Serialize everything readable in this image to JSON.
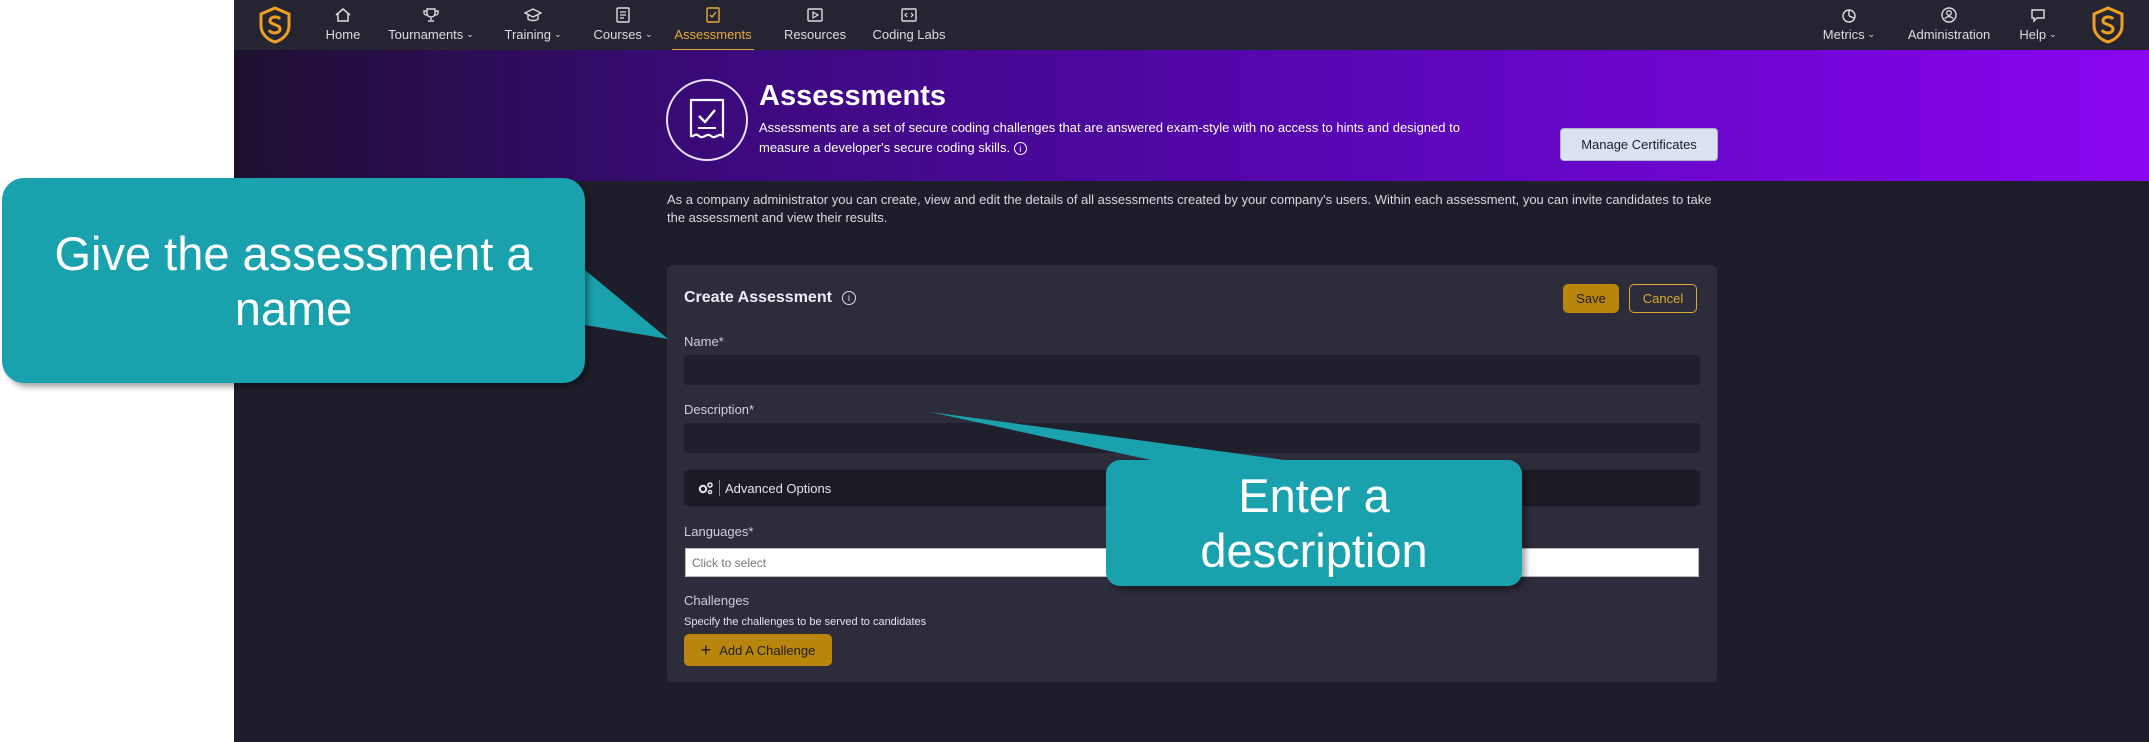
{
  "nav": {
    "items": [
      {
        "label": "Home",
        "icon": "home-icon",
        "dropdown": false
      },
      {
        "label": "Tournaments",
        "icon": "trophy-icon",
        "dropdown": true
      },
      {
        "label": "Training",
        "icon": "graduation-cap-icon",
        "dropdown": true
      },
      {
        "label": "Courses",
        "icon": "book-icon",
        "dropdown": true
      },
      {
        "label": "Assessments",
        "icon": "checklist-icon",
        "dropdown": false,
        "active": true
      },
      {
        "label": "Resources",
        "icon": "play-box-icon",
        "dropdown": false
      },
      {
        "label": "Coding Labs",
        "icon": "code-icon",
        "dropdown": false
      }
    ],
    "right_items": [
      {
        "label": "Metrics",
        "icon": "chart-icon",
        "dropdown": true
      },
      {
        "label": "Administration",
        "icon": "admin-user-icon",
        "dropdown": false
      },
      {
        "label": "Help",
        "icon": "chat-bubble-icon",
        "dropdown": true
      }
    ]
  },
  "hero": {
    "title": "Assessments",
    "description": "Assessments are a set of secure coding challenges that are answered exam-style with no access to hints and designed to measure a developer's secure coding skills.",
    "manage_label": "Manage Certificates"
  },
  "intro": "As a company administrator you can create, view and edit the details of all assessments created by your company's users. Within each assessment, you can invite candidates to take the assessment and view their results.",
  "form": {
    "title": "Create Assessment",
    "save_label": "Save",
    "cancel_label": "Cancel",
    "name_label": "Name*",
    "name_value": "",
    "description_label": "Description*",
    "description_value": "",
    "advanced_label": "Advanced Options",
    "languages_label": "Languages*",
    "languages_placeholder": "Click to select",
    "challenges_label": "Challenges",
    "challenges_hint": "Specify the challenges to be served to candidates",
    "add_challenge_label": "Add A Challenge"
  },
  "callouts": {
    "name_tip": "Give the assessment a name",
    "description_tip": "Enter a description"
  },
  "colors": {
    "accent": "#e8a93b",
    "callout": "#19a2ae",
    "nav_bg": "#252532",
    "page_bg": "#1e1e2a"
  }
}
